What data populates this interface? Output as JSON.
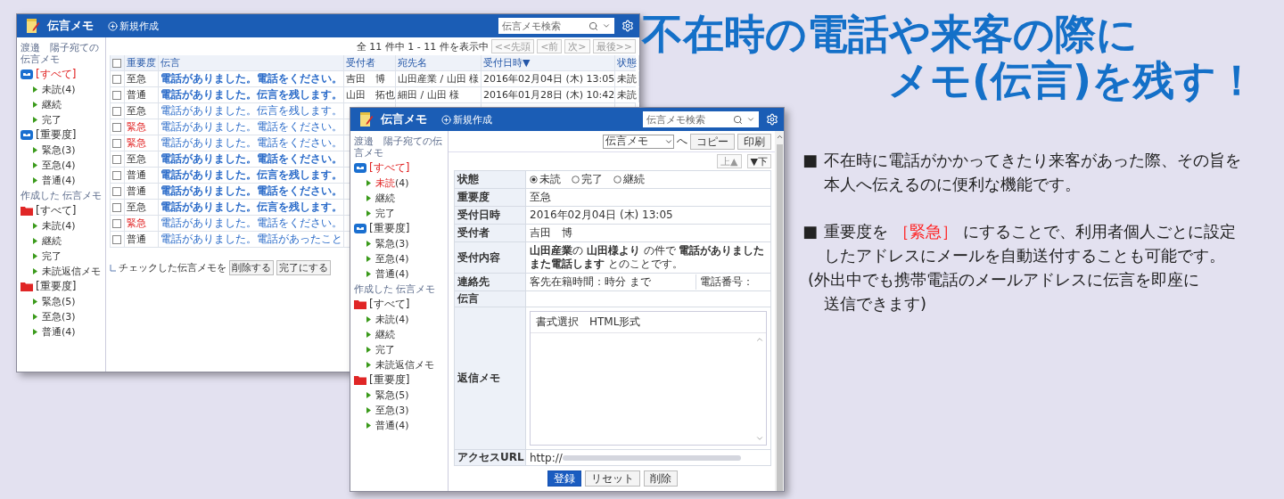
{
  "back_window": {
    "header": {
      "app_name": "伝言メモ",
      "new_button": "新規作成",
      "search": {
        "placeholder": "伝言メモ検索"
      }
    },
    "sidebar": {
      "sections": [
        {
          "heading": "渡邉　陽子宛ての伝言メモ",
          "groups": [
            {
              "label": "[すべて]",
              "selected": true,
              "children": [
                {
                  "label": "未読",
                  "count": "(4)",
                  "highlighted": false
                },
                {
                  "label": "継続",
                  "highlighted": false
                },
                {
                  "label": "完了",
                  "highlighted": false
                }
              ]
            },
            {
              "label": "[重要度]",
              "selected": false,
              "children": [
                {
                  "label": "緊急",
                  "count": "(3)",
                  "highlighted": false
                },
                {
                  "label": "至急",
                  "count": "(4)",
                  "highlighted": false
                },
                {
                  "label": "普通",
                  "count": "(4)",
                  "highlighted": false
                }
              ]
            }
          ]
        },
        {
          "heading": "作成した 伝言メモ",
          "groups": [
            {
              "label": "[すべて]",
              "selected": false,
              "children": [
                {
                  "label": "未読",
                  "count": "(4)",
                  "highlighted": false
                },
                {
                  "label": "継続",
                  "highlighted": false
                },
                {
                  "label": "完了",
                  "highlighted": false
                },
                {
                  "label": "未読返信メモ",
                  "highlighted": false
                }
              ]
            },
            {
              "label": "[重要度]",
              "selected": false,
              "children": [
                {
                  "label": "緊急",
                  "count": "(5)",
                  "highlighted": false
                },
                {
                  "label": "至急",
                  "count": "(3)",
                  "highlighted": false
                },
                {
                  "label": "普通",
                  "count": "(4)",
                  "highlighted": false
                }
              ]
            }
          ]
        }
      ]
    },
    "pager": {
      "summary": "全 11 件中 1 - 11 件を表示中",
      "buttons": [
        {
          "label": "<<先頭",
          "disabled": true
        },
        {
          "label": "<前",
          "disabled": true
        },
        {
          "label": "次>",
          "disabled": true
        },
        {
          "label": "最後>>",
          "disabled": true
        }
      ]
    },
    "table": {
      "select_all": {
        "checked": false
      },
      "columns": [
        "重要度",
        "伝言",
        "受付者",
        "宛先名",
        "受付日時▼",
        "状態"
      ],
      "rows": [
        {
          "checked": false,
          "importance": "至急",
          "urgent": false,
          "message": "電話がありました。電話をください。",
          "unread": true,
          "receiver": "吉田　博",
          "recipient": "山田産業 / 山田 様",
          "received": "2016年02月04日 (木) 13:05",
          "status": "未読"
        },
        {
          "checked": false,
          "importance": "普通",
          "urgent": false,
          "message": "電話がありました。伝言を残します。",
          "unread": true,
          "receiver": "山田　拓也",
          "recipient": "細田 / 山田 様",
          "received": "2016年01月28日 (木) 10:42",
          "status": "未読"
        },
        {
          "checked": false,
          "importance": "至急",
          "urgent": false,
          "message": "電話がありました。伝言を残します。",
          "unread": false
        },
        {
          "checked": false,
          "importance": "緊急",
          "urgent": true,
          "message": "電話がありました。電話をください。",
          "unread": false
        },
        {
          "checked": false,
          "importance": "緊急",
          "urgent": true,
          "message": "電話がありました。電話をください。",
          "unread": false
        },
        {
          "checked": false,
          "importance": "至急",
          "urgent": false,
          "message": "電話がありました。電話をください。",
          "unread": true
        },
        {
          "checked": false,
          "importance": "普通",
          "urgent": false,
          "message": "電話がありました。伝言を残します。",
          "unread": true
        },
        {
          "checked": false,
          "importance": "普通",
          "urgent": false,
          "message": "電話がありました。電話をください。",
          "unread": true
        },
        {
          "checked": false,
          "importance": "至急",
          "urgent": false,
          "message": "電話がありました。伝言を残します。",
          "unread": true
        },
        {
          "checked": false,
          "importance": "緊急",
          "urgent": true,
          "message": "電話がありました。電話をください。",
          "unread": false
        },
        {
          "checked": false,
          "importance": "普通",
          "urgent": false,
          "message": "電話がありました。電話があったこと",
          "unread": false
        }
      ]
    },
    "bulk_action": {
      "label": "チェックした伝言メモを",
      "buttons": [
        "削除する",
        "完了にする"
      ]
    }
  },
  "front_window": {
    "header": {
      "app_name": "伝言メモ",
      "new_button": "新規作成",
      "search": {
        "placeholder": "伝言メモ検索"
      }
    },
    "sidebar": {
      "sections": [
        {
          "heading": "渡邉　陽子宛ての伝言メモ",
          "groups": [
            {
              "label": "[すべて]",
              "selected": true,
              "children": [
                {
                  "label": "未読",
                  "count": "(4)",
                  "highlighted": true
                },
                {
                  "label": "継続",
                  "highlighted": false
                },
                {
                  "label": "完了",
                  "highlighted": false
                }
              ]
            },
            {
              "label": "[重要度]",
              "selected": false,
              "children": [
                {
                  "label": "緊急",
                  "count": "(3)",
                  "highlighted": false
                },
                {
                  "label": "至急",
                  "count": "(4)",
                  "highlighted": false
                },
                {
                  "label": "普通",
                  "count": "(4)",
                  "highlighted": false
                }
              ]
            }
          ]
        },
        {
          "heading": "作成した 伝言メモ",
          "groups": [
            {
              "label": "[すべて]",
              "selected": false,
              "children": [
                {
                  "label": "未読",
                  "count": "(4)",
                  "highlighted": false
                },
                {
                  "label": "継続",
                  "highlighted": false
                },
                {
                  "label": "完了",
                  "highlighted": false
                },
                {
                  "label": "未読返信メモ",
                  "highlighted": false
                }
              ]
            },
            {
              "label": "[重要度]",
              "selected": false,
              "children": [
                {
                  "label": "緊急",
                  "count": "(5)",
                  "highlighted": false
                },
                {
                  "label": "至急",
                  "count": "(3)",
                  "highlighted": false
                },
                {
                  "label": "普通",
                  "count": "(4)",
                  "highlighted": false
                }
              ]
            }
          ]
        }
      ]
    },
    "toolbar": {
      "destination": "伝言メモ",
      "suffix": "へ",
      "buttons": [
        "コピー",
        "印刷"
      ]
    },
    "nav": [
      {
        "label": "上▲",
        "disabled": true
      },
      {
        "label": "▼下",
        "disabled": false
      }
    ],
    "form": [
      {
        "kind": "radio",
        "label": "状態",
        "options": [
          {
            "label": "未読",
            "selected": true
          },
          {
            "label": "完了",
            "selected": false
          },
          {
            "label": "継続",
            "selected": false
          }
        ]
      },
      {
        "kind": "text",
        "label": "重要度",
        "value": "至急"
      },
      {
        "kind": "text",
        "label": "受付日時",
        "value": "2016年02月04日 (木) 13:05"
      },
      {
        "kind": "text",
        "label": "受付者",
        "value": "吉田　博"
      },
      {
        "kind": "rich",
        "label": "受付内容",
        "lines": [
          "**山田産業**の **山田様より** の件で **電話がありました**",
          "**また電話します** とのことです。"
        ]
      },
      {
        "kind": "contact",
        "label": "連絡先",
        "value": "客先在籍時間：時分 まで",
        "phone_label": "電話番号："
      },
      {
        "kind": "text",
        "label": "伝言"
      },
      {
        "kind": "editor",
        "label": "返信メモ",
        "toolbar": "書式選択　HTML形式"
      },
      {
        "kind": "url",
        "label": "アクセスURL",
        "value": "http://"
      }
    ],
    "buttons": [
      {
        "label": "登録",
        "primary": true
      },
      {
        "label": "リセット",
        "primary": false
      },
      {
        "label": "削除",
        "primary": false
      }
    ]
  },
  "headline": {
    "lines": [
      "不在時の電話や来客の際に",
      "メモ(伝言)を残す！"
    ]
  },
  "points": [
    {
      "bullet": "■",
      "lines": [
        [
          {
            "text": "不在時に電話がかかってきたり来客があった際、その旨を",
            "emphasis": false
          }
        ],
        [
          {
            "text": "本人へ伝えるのに便利な機能です。",
            "emphasis": false
          }
        ]
      ]
    },
    {
      "bullet": "■",
      "lines": [
        [
          {
            "text": "重要度を",
            "emphasis": false
          },
          {
            "text": "［緊急］",
            "emphasis": true
          },
          {
            "text": "にすることで、利用者個人ごとに設定",
            "emphasis": false
          }
        ],
        [
          {
            "text": "したアドレスにメールを自動送付することも可能です。",
            "emphasis": false
          }
        ]
      ]
    }
  ],
  "note": {
    "lines": [
      "(外出中でも携帯電話のメールアドレスに伝言を即座に",
      "送信できます)"
    ]
  }
}
